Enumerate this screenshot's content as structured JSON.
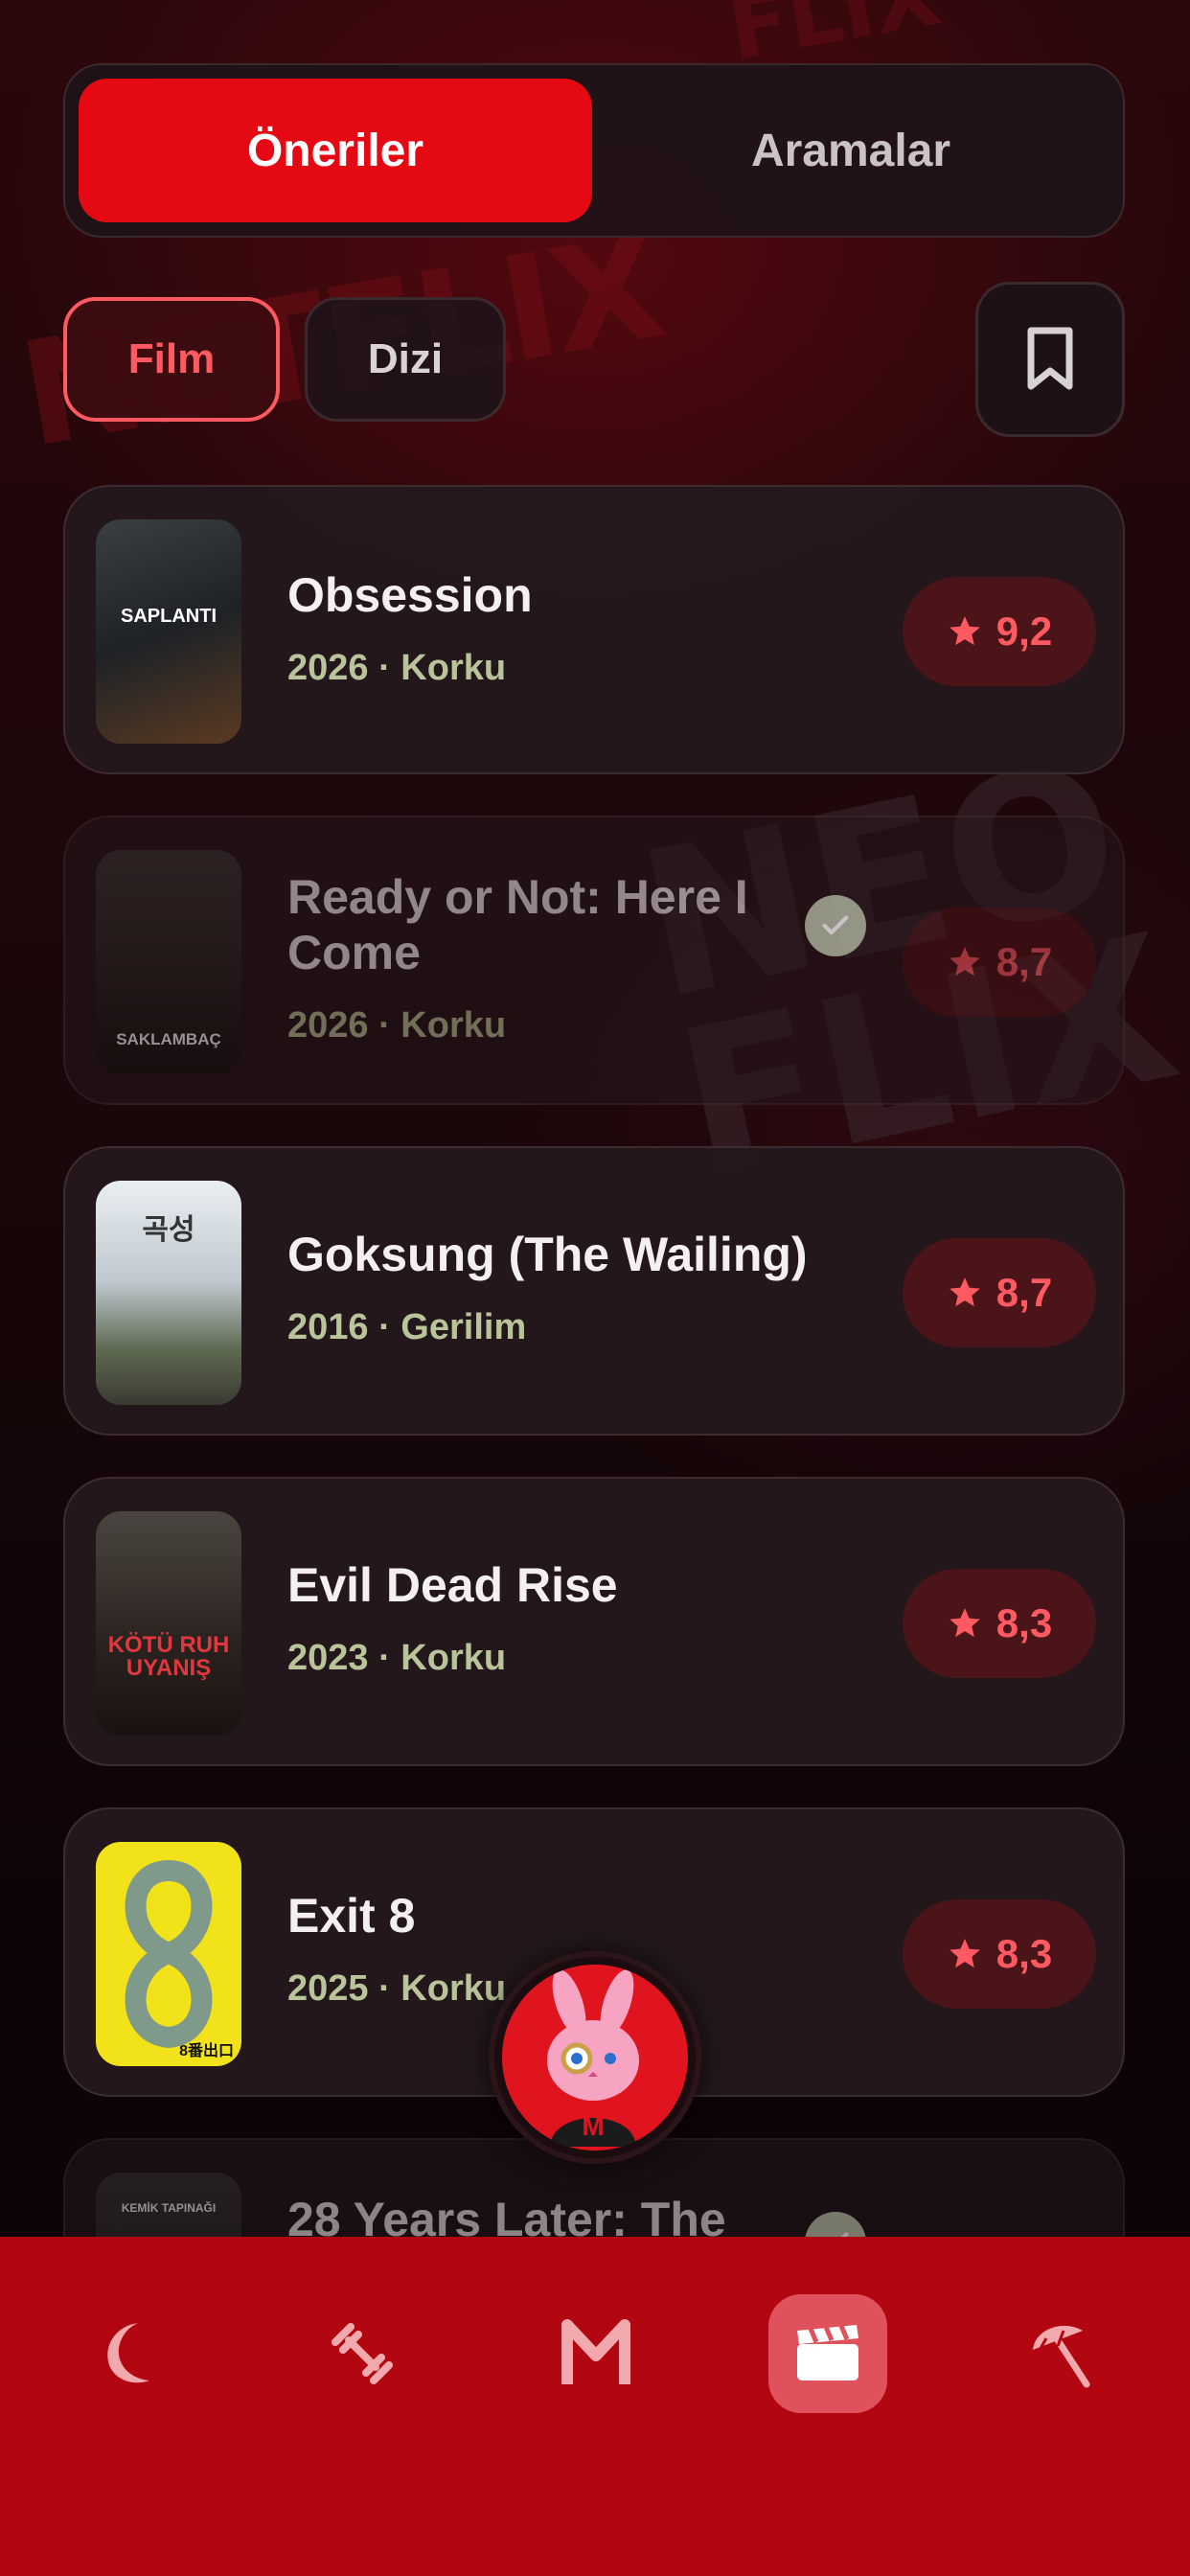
{
  "tabs": {
    "recommendations": "Öneriler",
    "searches": "Aramalar"
  },
  "filters": {
    "film": "Film",
    "series": "Dizi"
  },
  "watermark": {
    "text": "NETFLIX",
    "top_text": "FLIX"
  },
  "movies": [
    {
      "title": "Obsession",
      "meta": "2026 · Korku",
      "rating": "9,2",
      "poster_text": "SAPLANTI",
      "watched": false
    },
    {
      "title": "Ready or Not: Here I Come",
      "meta": "2026 · Korku",
      "rating": "8,7",
      "poster_text": "SAKLAMBAÇ",
      "watched": true
    },
    {
      "title": "Goksung (The Wailing)",
      "meta": "2016 · Gerilim",
      "rating": "8,7",
      "poster_text": "곡성",
      "watched": false
    },
    {
      "title": "Evil Dead Rise",
      "meta": "2023 · Korku",
      "rating": "8,3",
      "poster_text": "KÖTÜ RUH UYANIŞ",
      "watched": false
    },
    {
      "title": "Exit 8",
      "meta": "2025 · Korku",
      "rating": "8,3",
      "poster_text": "8番出口",
      "watched": false
    },
    {
      "title": "28 Years Later: The",
      "meta": "",
      "rating": "",
      "poster_text": "KEMİK TAPINAĞI",
      "watched": true
    }
  ],
  "mascot": {
    "letter": "M"
  },
  "bottom_nav": [
    {
      "icon": "moon-icon",
      "active": false
    },
    {
      "icon": "dumbbell-icon",
      "active": false
    },
    {
      "icon": "m-logo-icon",
      "label": "M",
      "active": false
    },
    {
      "icon": "clapperboard-icon",
      "active": true
    },
    {
      "icon": "beach-umbrella-icon",
      "active": false
    }
  ],
  "colors": {
    "accent": "#e50914",
    "rating_text": "#ff5a62",
    "nav_bg": "#b20710",
    "meta_text": "#b9c49a"
  }
}
